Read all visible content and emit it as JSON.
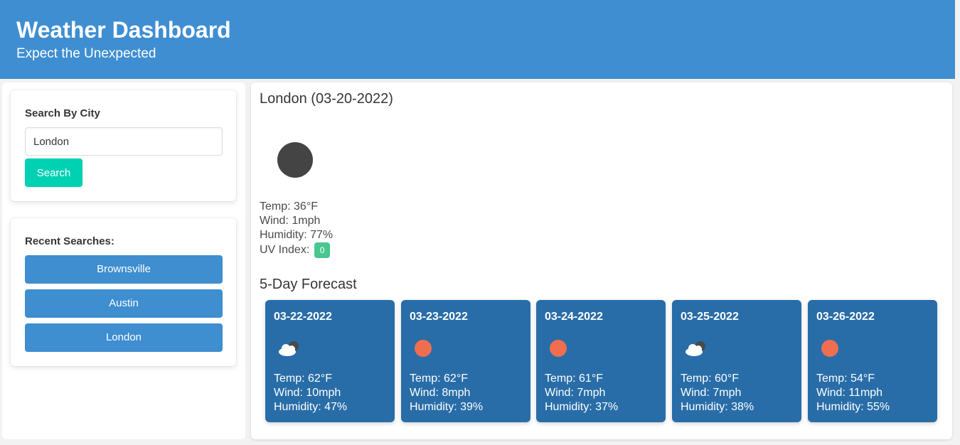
{
  "header": {
    "title": "Weather Dashboard",
    "subtitle": "Expect the Unexpected"
  },
  "search": {
    "label": "Search By City",
    "value": "London",
    "button_label": "Search"
  },
  "recent": {
    "label": "Recent Searches:",
    "items": [
      "Brownsville",
      "Austin",
      "London"
    ]
  },
  "current": {
    "title": "London (03-20-2022)",
    "icon": "dark-circle-icon",
    "temp": "Temp: 36°F",
    "wind": "Wind: 1mph",
    "humidity": "Humidity: 77%",
    "uv_label": "UV Index:",
    "uv_value": "0"
  },
  "forecast": {
    "title": "5-Day Forecast",
    "days": [
      {
        "date": "03-22-2022",
        "icon": "partly-cloudy-icon",
        "temp": "Temp: 62°F",
        "wind": "Wind: 10mph",
        "humidity": "Humidity: 47%"
      },
      {
        "date": "03-23-2022",
        "icon": "sun-icon",
        "temp": "Temp: 62°F",
        "wind": "Wind: 8mph",
        "humidity": "Humidity: 39%"
      },
      {
        "date": "03-24-2022",
        "icon": "sun-icon",
        "temp": "Temp: 61°F",
        "wind": "Wind: 7mph",
        "humidity": "Humidity: 37%"
      },
      {
        "date": "03-25-2022",
        "icon": "partly-cloudy-icon",
        "temp": "Temp: 60°F",
        "wind": "Wind: 7mph",
        "humidity": "Humidity: 38%"
      },
      {
        "date": "03-26-2022",
        "icon": "sun-icon",
        "temp": "Temp: 54°F",
        "wind": "Wind: 11mph",
        "humidity": "Humidity: 55%"
      }
    ]
  },
  "colors": {
    "header": "#3f8ed1",
    "search_button": "#00d1b2",
    "recent_button": "#3e8ed0",
    "forecast_card": "#286da8",
    "uv_badge": "#48c78e",
    "sun": "#ef6e4f"
  }
}
